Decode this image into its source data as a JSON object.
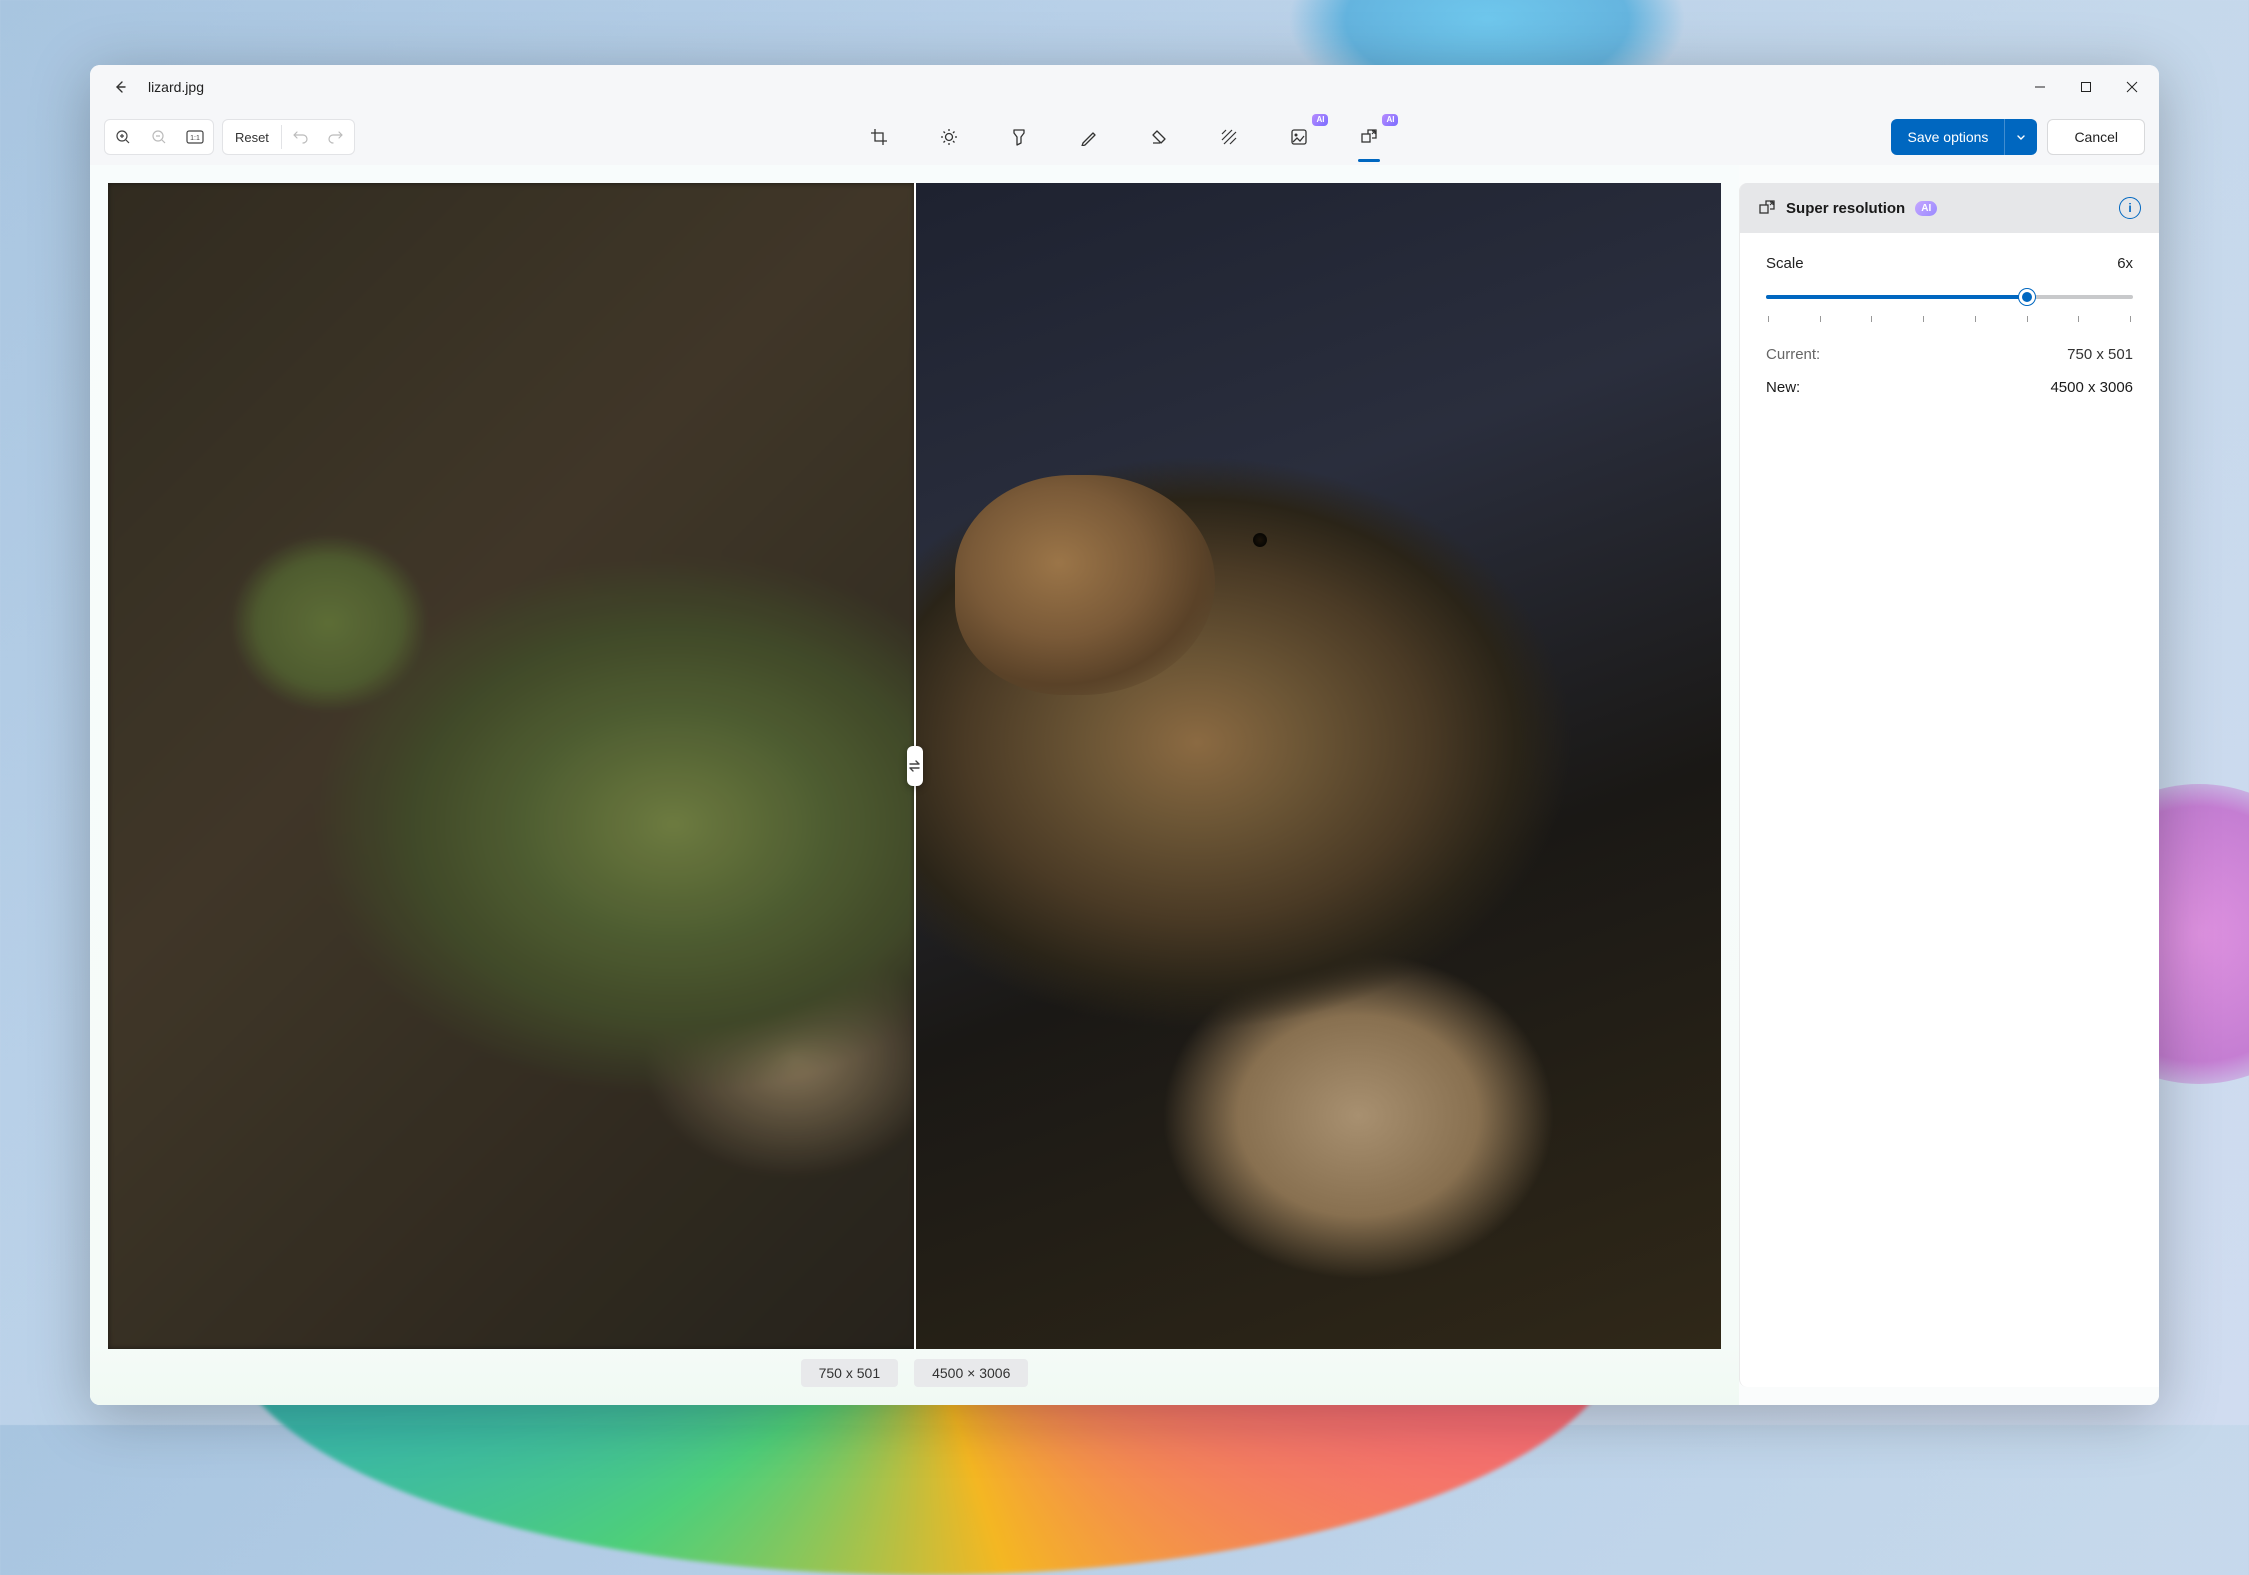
{
  "titlebar": {
    "filename": "lizard.jpg"
  },
  "toolbar": {
    "reset_label": "Reset",
    "save_label": "Save options",
    "cancel_label": "Cancel",
    "ai_badge": "AI"
  },
  "compare": {
    "left_dim": "750 x 501",
    "right_dim": "4500 × 3006"
  },
  "panel": {
    "title": "Super resolution",
    "ai_badge": "AI",
    "scale_label": "Scale",
    "scale_value": "6x",
    "current_label": "Current:",
    "current_value": "750 x 501",
    "new_label": "New:",
    "new_value": "4500 x 3006"
  }
}
